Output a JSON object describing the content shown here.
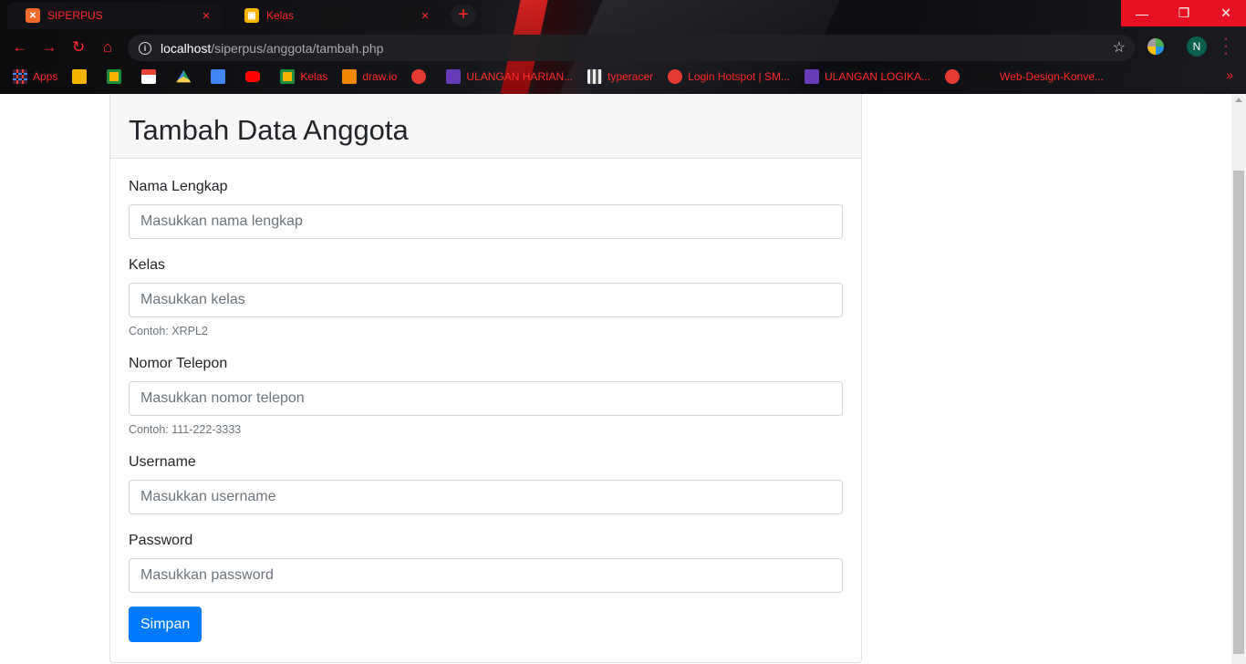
{
  "browser": {
    "tabs": [
      {
        "title": "SIPERPUS",
        "active": true,
        "favicon_color": "#f36b2a",
        "favicon_icon": "xampp-icon"
      },
      {
        "title": "Kelas",
        "active": false,
        "favicon_color": "#f4b400",
        "favicon_icon": "classroom-icon"
      }
    ],
    "url_host": "localhost",
    "url_path": "/siperpus/anggota/tambah.php",
    "profile_initial": "N",
    "accent_color": "#ff2a2a",
    "bookmarks": [
      {
        "label": "Apps",
        "icon": "apps-grid-icon",
        "color": "#e0e0e0"
      },
      {
        "label": "",
        "icon": "slides-icon",
        "color": "#f4b400"
      },
      {
        "label": "",
        "icon": "classroom-icon",
        "color": "#f4b400"
      },
      {
        "label": "",
        "icon": "gmail-icon",
        "color": "#ffffff"
      },
      {
        "label": "",
        "icon": "drive-icon",
        "color": "#1fa463"
      },
      {
        "label": "",
        "icon": "docs-icon",
        "color": "#4285f4"
      },
      {
        "label": "",
        "icon": "youtube-icon",
        "color": "#ff0000"
      },
      {
        "label": "Kelas",
        "icon": "classroom-icon",
        "color": "#f4b400"
      },
      {
        "label": "draw.io",
        "icon": "drawio-icon",
        "color": "#f08705"
      },
      {
        "label": "",
        "icon": "globe-icon",
        "color": "#e53935"
      },
      {
        "label": "ULANGAN HARIAN...",
        "icon": "forms-icon",
        "color": "#673ab7"
      },
      {
        "label": "typeracer",
        "icon": "typeracer-icon",
        "color": "#cfcfcf"
      },
      {
        "label": "Login Hotspot | SM...",
        "icon": "globe-icon",
        "color": "#e53935"
      },
      {
        "label": "ULANGAN LOGIKA...",
        "icon": "forms-icon",
        "color": "#673ab7"
      },
      {
        "label": "",
        "icon": "globe-icon",
        "color": "#e53935"
      },
      {
        "label": "Web-Design-Konve...",
        "icon": "github-icon",
        "color": "#111111"
      }
    ]
  },
  "page": {
    "title": "Tambah Data Anggota",
    "fields": [
      {
        "label": "Nama Lengkap",
        "placeholder": "Masukkan nama lengkap",
        "value": "",
        "help": ""
      },
      {
        "label": "Kelas",
        "placeholder": "Masukkan kelas",
        "value": "",
        "help": "Contoh: XRPL2"
      },
      {
        "label": "Nomor Telepon",
        "placeholder": "Masukkan nomor telepon",
        "value": "",
        "help": "Contoh: 111-222-3333"
      },
      {
        "label": "Username",
        "placeholder": "Masukkan username",
        "value": "",
        "help": ""
      },
      {
        "label": "Password",
        "placeholder": "Masukkan password",
        "value": "",
        "help": ""
      }
    ],
    "submit_label": "Simpan",
    "primary_color": "#007bff"
  }
}
